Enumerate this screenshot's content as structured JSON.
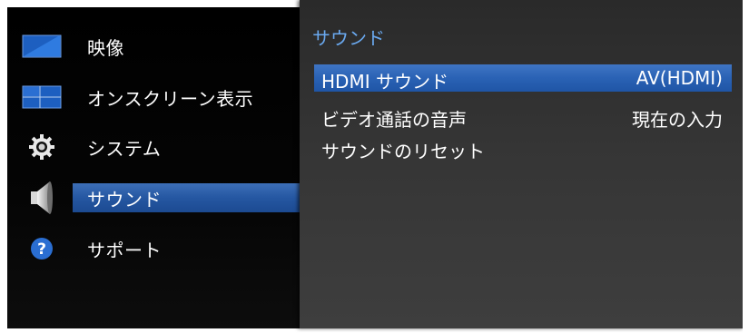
{
  "main_menu": {
    "items": [
      {
        "label": "映像",
        "icon": "picture-icon"
      },
      {
        "label": "オンスクリーン表示",
        "icon": "onscreen-display-icon"
      },
      {
        "label": "システム",
        "icon": "gear-icon"
      },
      {
        "label": "サウンド",
        "icon": "speaker-icon"
      },
      {
        "label": "サポート",
        "icon": "help-icon"
      }
    ],
    "selected_index": 3
  },
  "sub_menu": {
    "title": "サウンド",
    "items": [
      {
        "label": "HDMI サウンド",
        "value": "AV(HDMI)"
      },
      {
        "label": "ビデオ通話の音声",
        "value": "現在の入力"
      },
      {
        "label": "サウンドのリセット",
        "value": ""
      }
    ],
    "selected_index": 0
  },
  "colors": {
    "highlight": "#2557a2",
    "title": "#6aa9f0",
    "panel_left": "#000000",
    "panel_right": "#353535"
  }
}
